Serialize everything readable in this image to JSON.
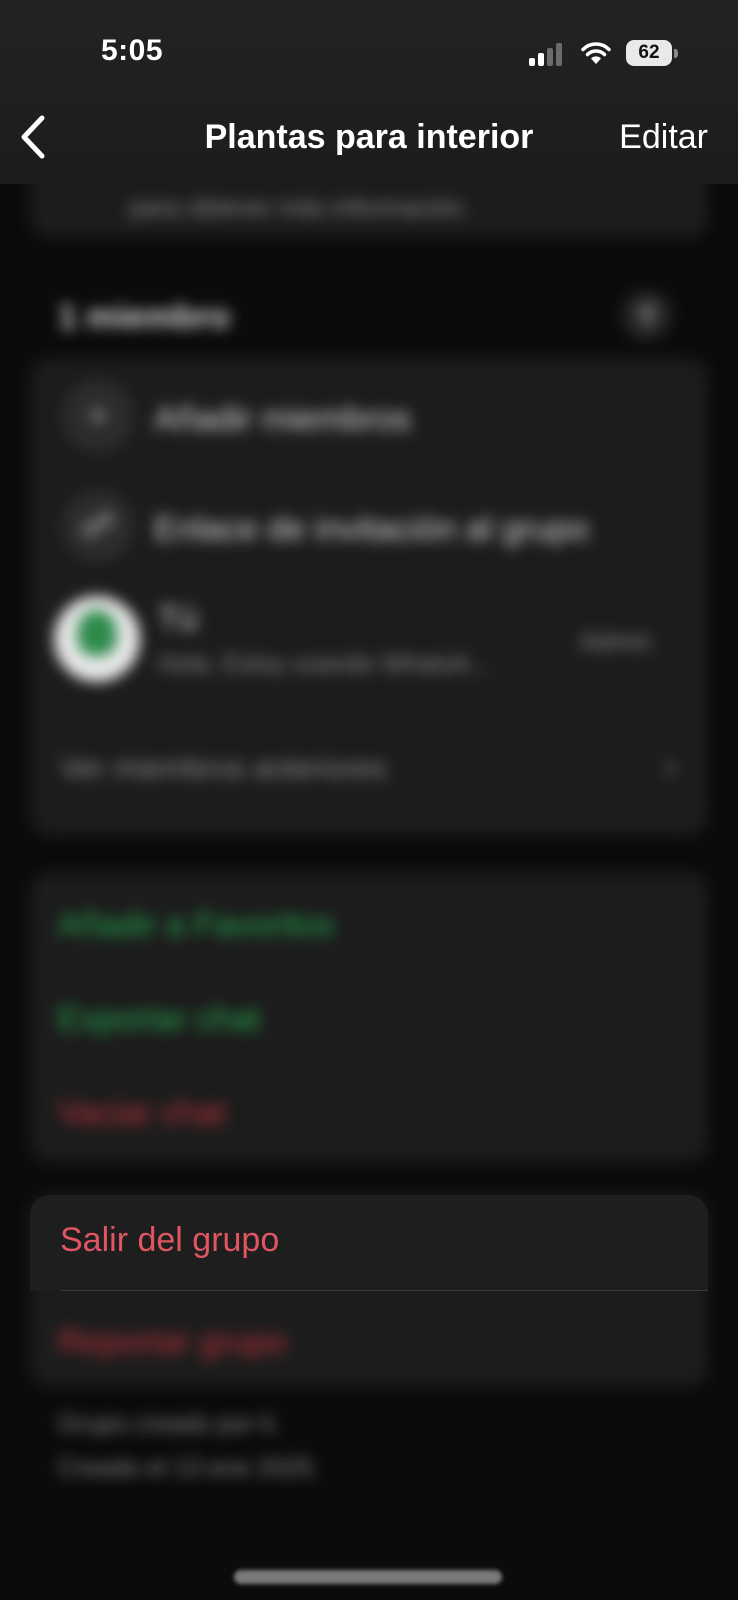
{
  "status_bar": {
    "time": "5:05",
    "battery": "62",
    "icons": [
      "cellular-signal-icon",
      "wifi-icon",
      "battery-icon"
    ]
  },
  "nav": {
    "back_icon": "chevron-left-icon",
    "title": "Plantas para interior",
    "edit_label": "Editar"
  },
  "description": {
    "text": "para obtener más información."
  },
  "members": {
    "header": "1 miembro",
    "search_icon": "search-icon",
    "add_members": "Añadir miembros",
    "invite_link": "Enlace de invitación al grupo",
    "member_name": "Tú",
    "member_status": "Hola. Estoy usando WhatsA...",
    "member_role": "Admin",
    "past_members": "Ver miembros anteriores"
  },
  "actions": {
    "add_favorites": "Añadir a Favoritos",
    "export_chat": "Exportar chat",
    "clear_chat": "Vaciar chat"
  },
  "danger": {
    "exit_group": "Salir del grupo",
    "report_group": "Reportar grupo"
  },
  "footer": {
    "created_by": "Grupo creado por ti.",
    "created_on": "Creado el 13 ene 2025."
  },
  "colors": {
    "accent_green": "#23a64a",
    "danger_red": "#e05562",
    "background": "#0b0b0b",
    "card": "#1c1c1c"
  }
}
